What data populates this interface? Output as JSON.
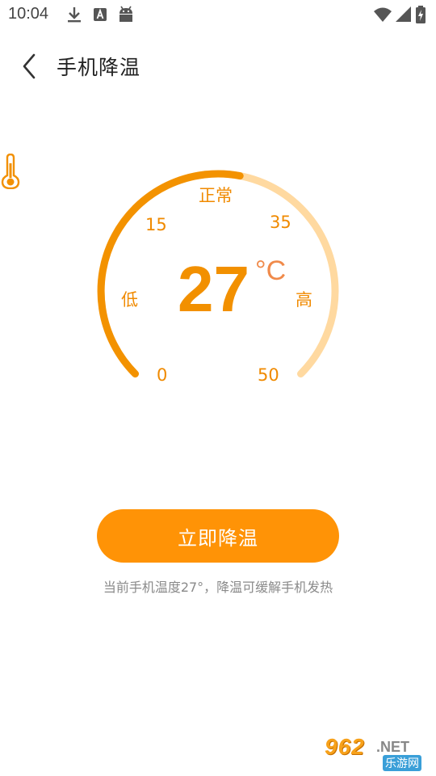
{
  "status_bar": {
    "time": "10:04",
    "icons": [
      "download-icon",
      "a-notification-icon",
      "android-icon",
      "wifi-icon",
      "cell-signal-icon",
      "battery-icon"
    ]
  },
  "header": {
    "back_icon": "back-arrow-icon",
    "title": "手机降温"
  },
  "gauge": {
    "status_label": "正常",
    "low_label": "低",
    "high_label": "高",
    "ticks": {
      "t0": "0",
      "t15": "15",
      "t35": "35",
      "t50": "50"
    },
    "temperature": "27",
    "unit": "°C",
    "range_min": 0,
    "range_max": 50,
    "active_color": "#f39200",
    "track_color": "#ffd9a0",
    "thermometer_icon": "thermometer-icon"
  },
  "action": {
    "button_label": "立即降温",
    "button_color": "#ff9306",
    "hint": "当前手机温度27°，降温可缓解手机发热"
  },
  "watermark": {
    "brand_number": "962",
    "brand_suffix": ".NET",
    "brand_cn": "乐游网"
  }
}
